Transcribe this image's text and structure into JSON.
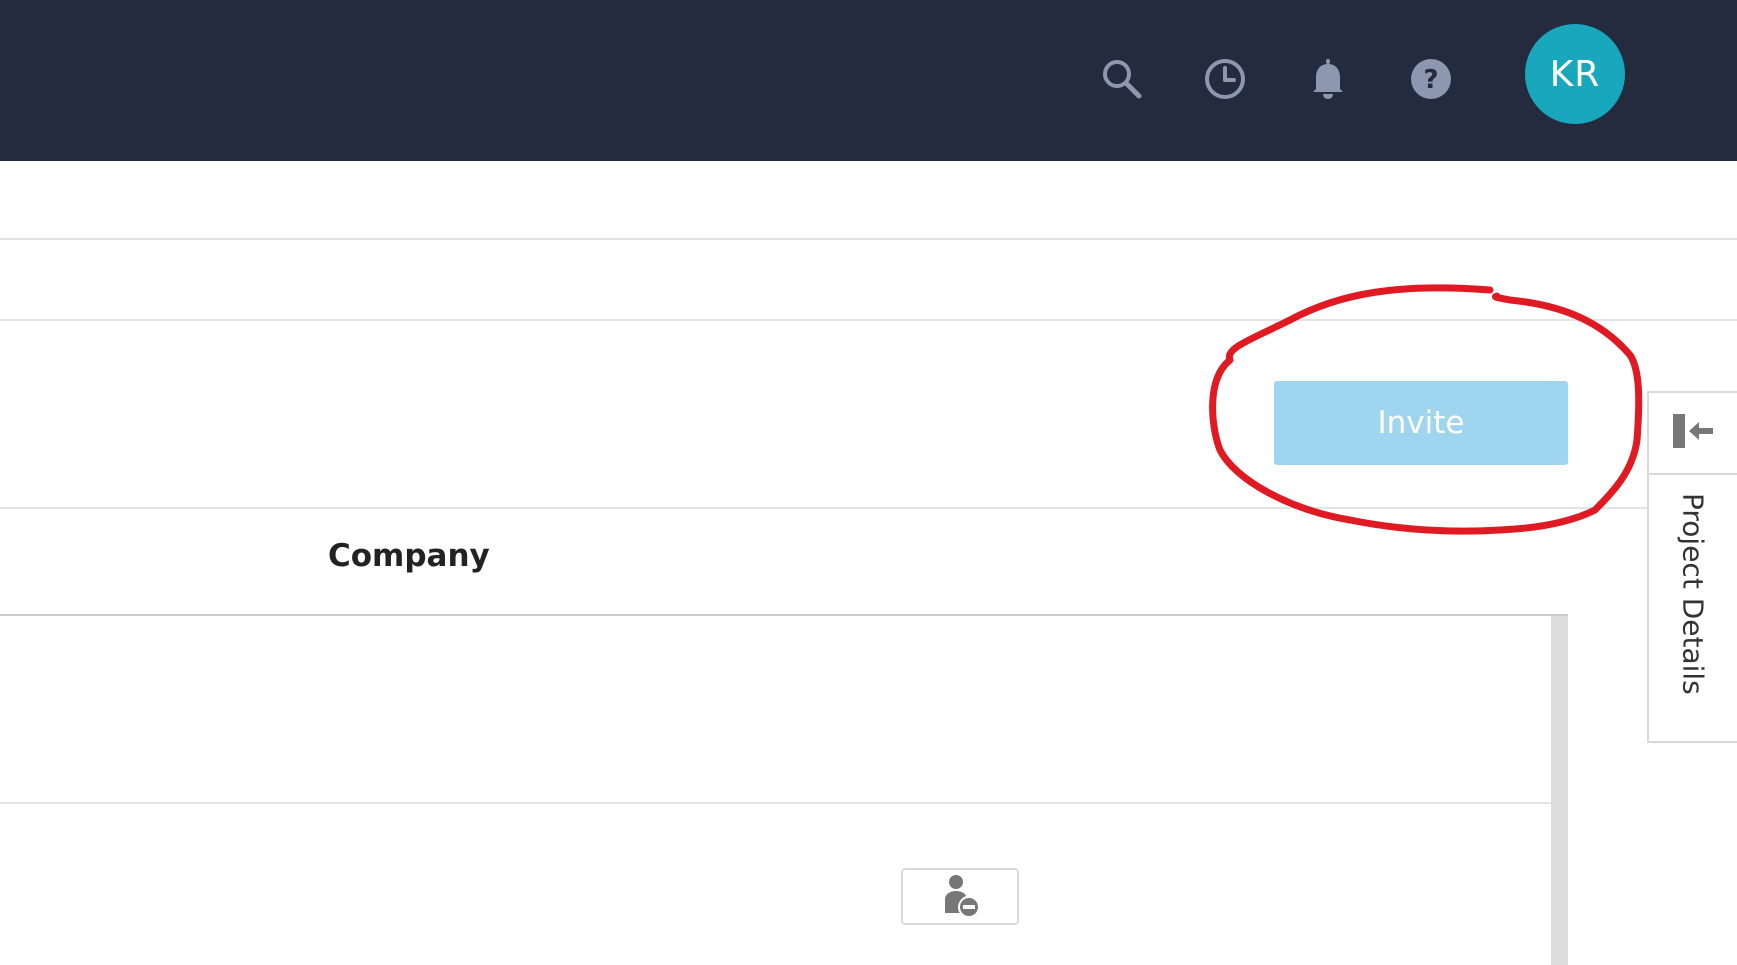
{
  "header": {
    "icons": [
      "search-icon",
      "clock-icon",
      "bell-icon",
      "help-icon"
    ],
    "avatar_initials": "KR",
    "avatar_color": "#19a7be",
    "background_color": "#252b3e"
  },
  "toolbar": {
    "invite_label": "Invite",
    "invite_color": "#9fd5ef"
  },
  "table": {
    "columns": [
      {
        "label": "Company"
      }
    ],
    "rows": [
      {
        "action_icon": "remove-user-icon"
      }
    ]
  },
  "side_panel": {
    "toggle_icon": "collapse-panel-icon",
    "tab_label": "Project Details"
  },
  "annotation": {
    "color": "#e01a22"
  }
}
